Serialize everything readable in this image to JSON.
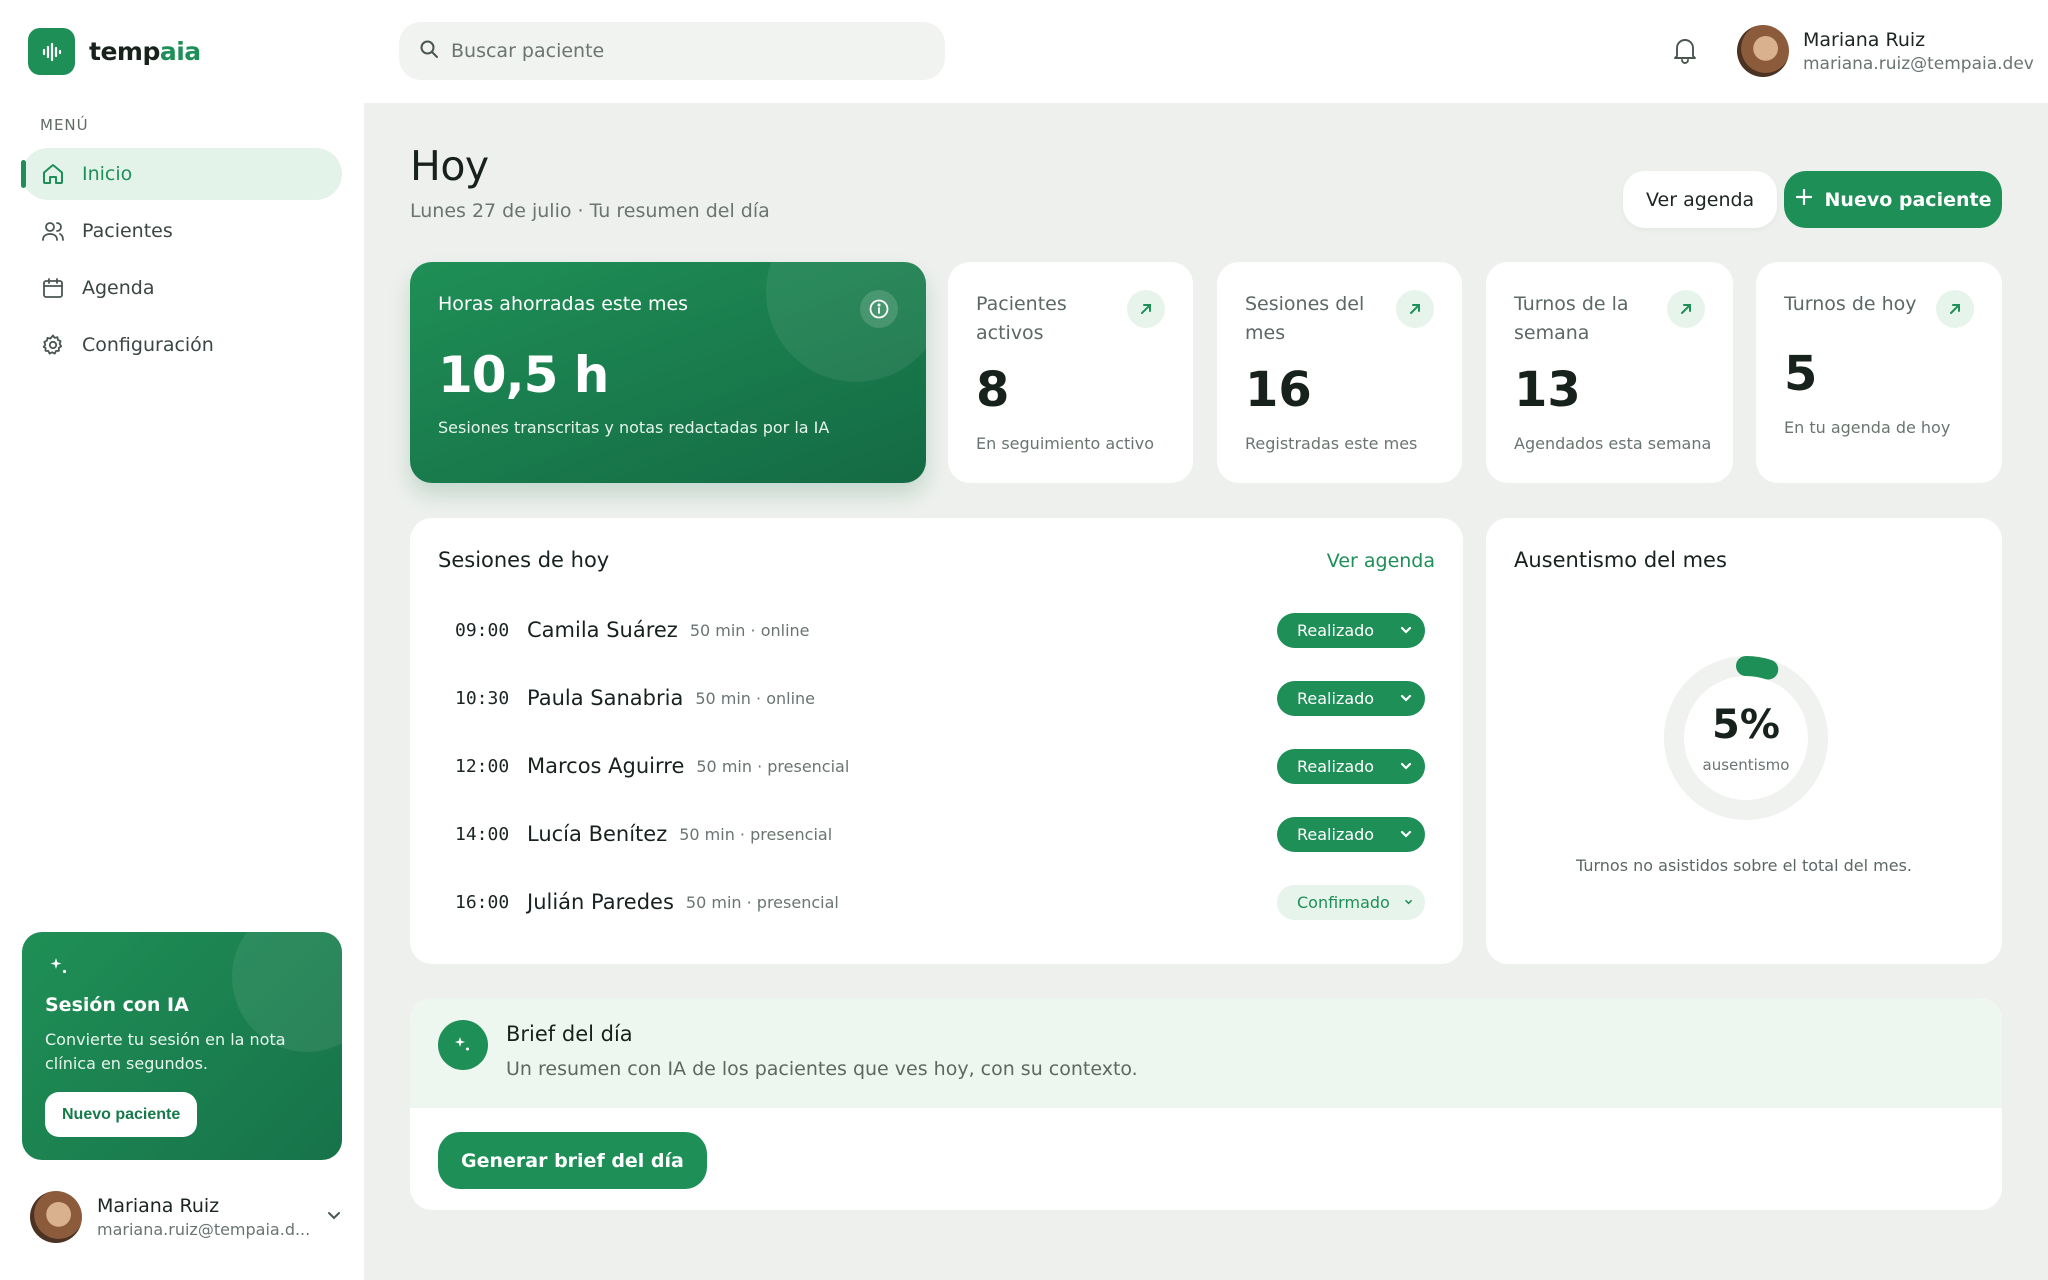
{
  "brand": {
    "name_part1": "temp",
    "name_part2": "aia",
    "accent": "#1e8f57"
  },
  "sidebar": {
    "menu_label": "MENÚ",
    "items": [
      {
        "label": "Inicio",
        "icon": "home-icon",
        "active": true
      },
      {
        "label": "Pacientes",
        "icon": "users-icon",
        "active": false
      },
      {
        "label": "Agenda",
        "icon": "calendar-icon",
        "active": false
      },
      {
        "label": "Configuración",
        "icon": "gear-icon",
        "active": false
      }
    ],
    "promo": {
      "title": "Sesión con IA",
      "description": "Convierte tu sesión en la nota clínica en segundos.",
      "button": "Nuevo paciente"
    },
    "user": {
      "name": "Mariana Ruiz",
      "email": "mariana.ruiz@tempaia.d..."
    }
  },
  "topbar": {
    "search_placeholder": "Buscar paciente",
    "user": {
      "name": "Mariana Ruiz",
      "email": "mariana.ruiz@tempaia.dev"
    }
  },
  "header": {
    "title": "Hoy",
    "subtitle": "Lunes 27 de julio · Tu resumen del día",
    "secondary_button": "Ver agenda",
    "primary_button": "Nuevo paciente"
  },
  "hero": {
    "label": "Horas ahorradas este mes",
    "value": "10,5 h",
    "description": "Sesiones transcritas y notas redactadas por la IA"
  },
  "stats": [
    {
      "label": "Pacientes activos",
      "value": "8",
      "description": "En seguimiento activo"
    },
    {
      "label": "Sesiones del mes",
      "value": "16",
      "description": "Registradas este mes"
    },
    {
      "label": "Turnos de la semana",
      "value": "13",
      "description": "Agendados esta semana"
    },
    {
      "label": "Turnos de hoy",
      "value": "5",
      "description": "En tu agenda de hoy"
    }
  ],
  "sessions": {
    "title": "Sesiones de hoy",
    "link": "Ver agenda",
    "rows": [
      {
        "time": "09:00",
        "name": "Camila Suárez",
        "meta": "50 min · online",
        "status": "Realizado"
      },
      {
        "time": "10:30",
        "name": "Paula Sanabria",
        "meta": "50 min · online",
        "status": "Realizado"
      },
      {
        "time": "12:00",
        "name": "Marcos Aguirre",
        "meta": "50 min · presencial",
        "status": "Realizado"
      },
      {
        "time": "14:00",
        "name": "Lucía Benítez",
        "meta": "50 min · presencial",
        "status": "Realizado"
      },
      {
        "time": "16:00",
        "name": "Julián Paredes",
        "meta": "50 min · presencial",
        "status": "Confirmado"
      }
    ]
  },
  "absence": {
    "title": "Ausentismo del mes",
    "value": "5%",
    "fraction": 0.05,
    "label": "ausentismo",
    "description": "Turnos no asistidos sobre el total del mes."
  },
  "brief": {
    "title": "Brief del día",
    "description": "Un resumen con IA de los pacientes que ves hoy, con su contexto.",
    "button": "Generar brief del día"
  }
}
